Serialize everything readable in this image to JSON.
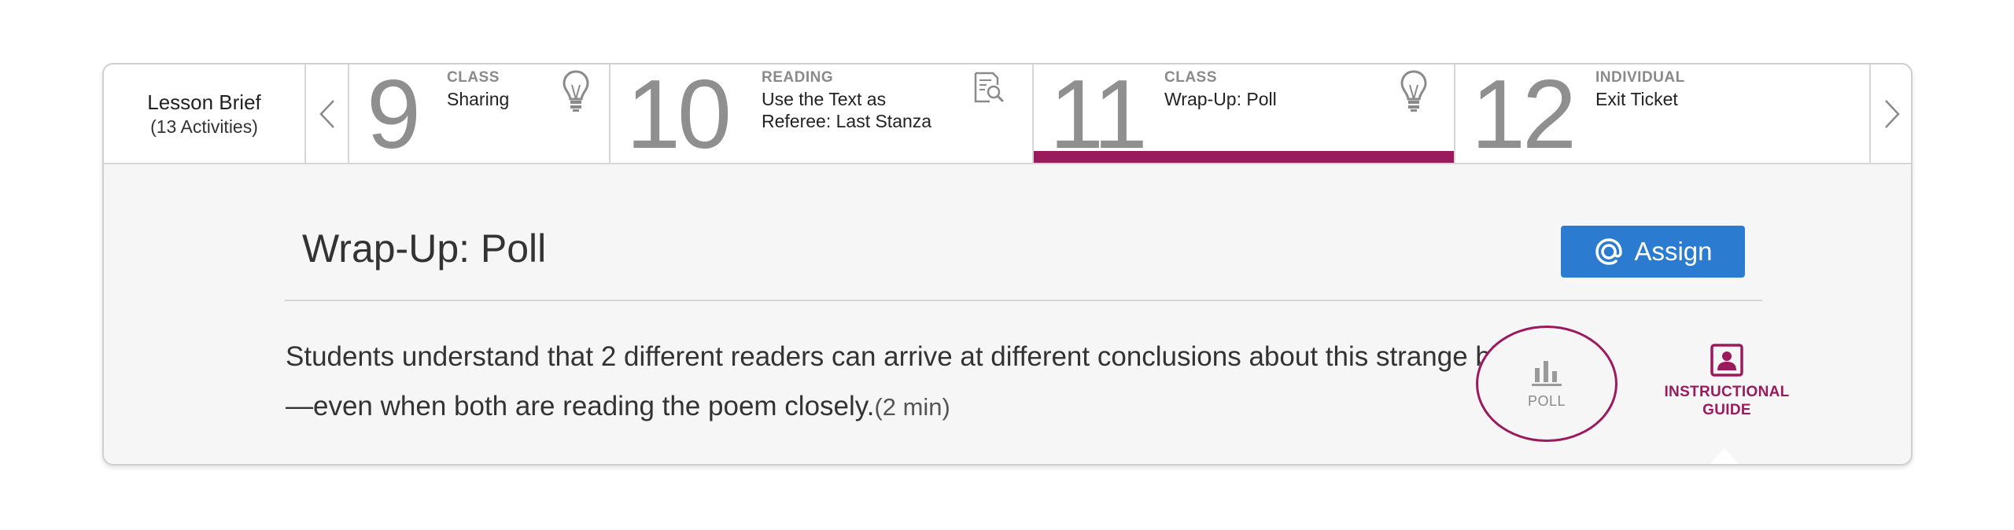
{
  "brief": {
    "title": "Lesson Brief",
    "count": "(13 Activities)"
  },
  "activities": [
    {
      "number": "9",
      "type": "CLASS",
      "name": "Sharing",
      "icon": "lightbulb-icon"
    },
    {
      "number": "10",
      "type": "READING",
      "name_line1": "Use the Text as",
      "name_line2": "Referee: Last Stanza",
      "icon": "document-search-icon"
    },
    {
      "number": "11",
      "type": "CLASS",
      "name": "Wrap-Up: Poll",
      "icon": "lightbulb-icon",
      "selected": true
    },
    {
      "number": "12",
      "type": "INDIVIDUAL",
      "name": "Exit Ticket"
    }
  ],
  "detail": {
    "title": "Wrap-Up: Poll",
    "assign_label": "Assign",
    "description": "Students understand that 2 different readers can arrive at different conclusions about this strange bird—even when both are reading the poem closely.",
    "duration": "(2 min)"
  },
  "modes": {
    "poll_label": "POLL",
    "guide_label": "INSTRUCTIONAL GUIDE"
  },
  "colors": {
    "accent": "#9b1a5e",
    "button": "#2b7bd1"
  }
}
